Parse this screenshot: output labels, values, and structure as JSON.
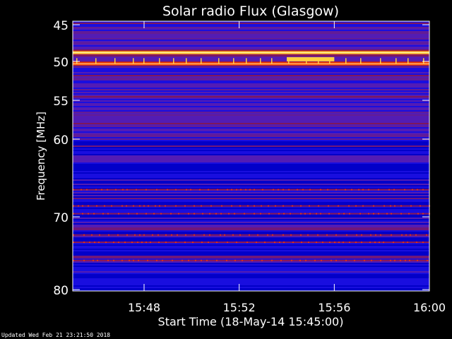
{
  "chart_data": {
    "type": "heatmap",
    "title": "Solar radio Flux (Glasgow)",
    "xlabel": "Start Time (18-May-14 15:45:00)",
    "ylabel": "Frequency [MHz]",
    "x_range": [
      "15:45:00",
      "16:00:00"
    ],
    "y_range_mhz": [
      45,
      80
    ],
    "x_ticks": [
      "15:48",
      "15:52",
      "15:56",
      "16:00"
    ],
    "y_ticks": [
      45,
      50,
      55,
      60,
      70,
      80
    ],
    "y_scale": "nonlinear (compressed toward higher frequency)",
    "colormap": [
      "#0000c8",
      "#1a10e0",
      "#5a1fb0",
      "#8a1a50",
      "#c81e10",
      "#ff6a00",
      "#ffd040"
    ],
    "bright_bands_mhz": [
      {
        "freq": 48.8,
        "color": "#ffd040",
        "note": "persistent interference line"
      },
      {
        "freq": 50.3,
        "color": "#ff5000",
        "note": "persistent interference line"
      }
    ],
    "bursts": [
      {
        "time": "15:54:00-15:56:00",
        "freq": 49.7,
        "color": "#ffd040"
      }
    ],
    "noise_rows_mhz": [
      66.5,
      68.6,
      69.6,
      72.5,
      73.5,
      76.0
    ]
  },
  "footer": {
    "updated": "Updated Wed Feb 21 23:21:50 2018"
  }
}
